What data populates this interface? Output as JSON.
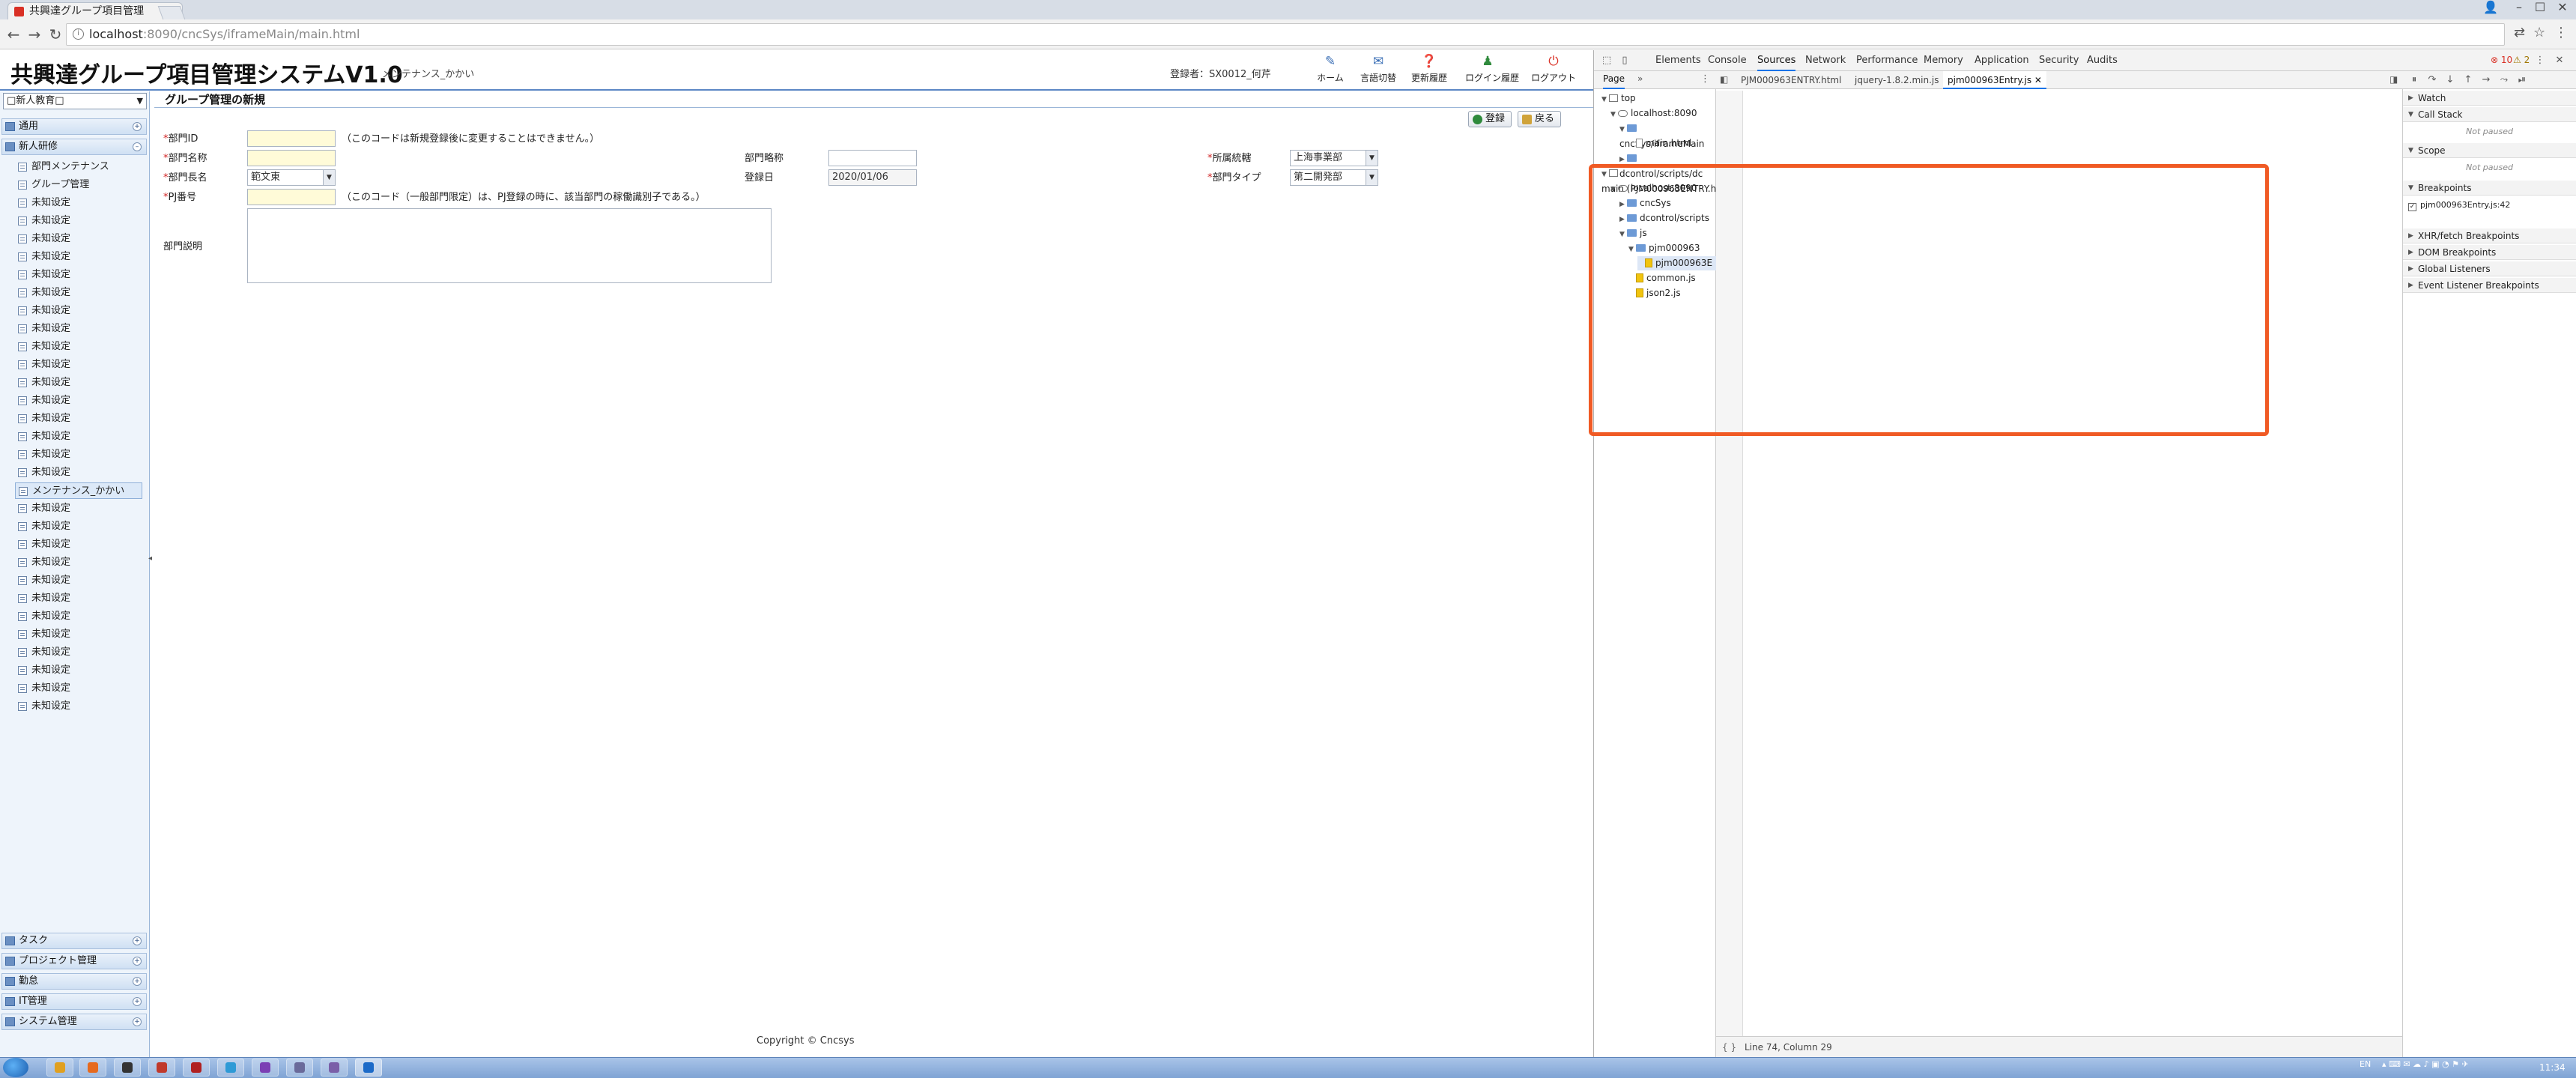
{
  "browser": {
    "tab_title": "共興達グループ項目管理",
    "url_host": "localhost",
    "url_path": ":8090/cncSys/iframeMain/main.html"
  },
  "app": {
    "title": "共興達グループ項目管理システムV1.0",
    "subtitle": "メンテナンス_かかい",
    "user_info": "登録者：SX0012_何芹",
    "header_buttons": [
      {
        "label": "ホーム",
        "icon": "home-icon"
      },
      {
        "label": "言語切替",
        "icon": "language-icon"
      },
      {
        "label": "更新履歴",
        "icon": "history-icon"
      },
      {
        "label": "ログイン履歴",
        "icon": "login-history-icon"
      },
      {
        "label": "ログアウト",
        "icon": "logout-icon"
      }
    ],
    "sidebar": {
      "dropdown_value": "□新人教育□",
      "sections_top": [
        {
          "label": "通用"
        },
        {
          "label": "新人研修"
        }
      ],
      "items": [
        "部門メンテナンス",
        "グループ管理",
        "未知设定",
        "未知设定",
        "未知设定",
        "未知设定",
        "未知设定",
        "未知设定",
        "未知设定",
        "未知设定",
        "未知设定",
        "未知设定",
        "未知设定",
        "未知设定",
        "未知设定",
        "未知设定",
        "未知设定",
        "未知设定",
        "メンテナンス_かかい",
        "未知设定",
        "未知设定",
        "未知设定",
        "未知设定",
        "未知设定",
        "未知设定",
        "未知设定",
        "未知设定",
        "未知设定",
        "未知设定",
        "未知设定",
        "未知设定"
      ],
      "selected_index": 18,
      "sections_bottom": [
        {
          "label": "タスク"
        },
        {
          "label": "プロジェクト管理"
        },
        {
          "label": "勤怠"
        },
        {
          "label": "IT管理"
        },
        {
          "label": "システム管理"
        }
      ]
    },
    "content": {
      "title": "グループ管理の新規",
      "buttons": {
        "save": "登録",
        "back": "戻る"
      },
      "fields": {
        "dept_id_label": "部門ID",
        "dept_id_value": "",
        "dept_id_note": "（このコードは新規登録後に変更することはできません。）",
        "dept_name_label": "部門名称",
        "dept_name_value": "",
        "dept_abbr_label": "部門略称",
        "dept_abbr_value": "",
        "supervisor_label": "所属統轄",
        "supervisor_value": "上海事業部",
        "manager_label": "部門長名",
        "manager_value": "範文東",
        "reg_date_label": "登録日",
        "reg_date_value": "2020/01/06",
        "dept_type_label": "部門タイプ",
        "dept_type_value": "第二開発部",
        "cost_code_label": "PJ番号",
        "cost_code_value": "",
        "cost_code_note": "（このコード（一般部門限定）は、PJ登録の時に、該当部門の稼働識別子である。）",
        "desc_label": "部門説明",
        "desc_value": ""
      },
      "copyright": "Copyright © Cncsys"
    }
  },
  "devtools": {
    "tabs": [
      "Elements",
      "Console",
      "Sources",
      "Network",
      "Performance",
      "Memory",
      "Application",
      "Security",
      "Audits"
    ],
    "active_tab": "Sources",
    "error_count": "10",
    "warning_count": "2",
    "navigator_tabs": [
      "Page",
      "»"
    ],
    "tree": [
      {
        "label": "top",
        "indent": 0,
        "type": "frame",
        "open": true
      },
      {
        "label": "localhost:8090",
        "indent": 1,
        "type": "cloud",
        "open": true
      },
      {
        "label": "cncSys/iframeMain",
        "indent": 2,
        "type": "folder",
        "open": true
      },
      {
        "label": "main.html",
        "indent": 3,
        "type": "file"
      },
      {
        "label": "dcontrol/scripts/dc",
        "indent": 2,
        "type": "folder",
        "open": false
      },
      {
        "label": "main (PJM000963ENTRY.h",
        "indent": 0,
        "type": "frame",
        "open": true
      },
      {
        "label": "localhost:8090",
        "indent": 1,
        "type": "cloud",
        "open": true
      },
      {
        "label": "cncSys",
        "indent": 2,
        "type": "folder",
        "open": false
      },
      {
        "label": "dcontrol/scripts",
        "indent": 2,
        "type": "folder",
        "open": false
      },
      {
        "label": "js",
        "indent": 2,
        "type": "folder",
        "open": true
      },
      {
        "label": "pjm000963",
        "indent": 3,
        "type": "folder",
        "open": true
      },
      {
        "label": "pjm000963E",
        "indent": 4,
        "type": "js",
        "selected": true
      },
      {
        "label": "common.js",
        "indent": 3,
        "type": "js"
      },
      {
        "label": "json2.js",
        "indent": 3,
        "type": "js"
      }
    ],
    "editor_tabs": [
      "PJM000963ENTRY.html",
      "jquery-1.8.2.min.js",
      "pjm000963Entry.js"
    ],
    "active_editor_tab": 2,
    "status": "Line 74, Column 29",
    "debug": {
      "sections": [
        "Watch",
        "Call Stack",
        "Scope",
        "Breakpoints",
        "XHR/fetch Breakpoints",
        "DOM Breakpoints",
        "Global Listeners",
        "Event Listener Breakpoints"
      ],
      "not_paused": "Not paused",
      "breakpoint_label": "pjm000963Entry.js:42"
    }
  },
  "taskbar": {
    "tray_lang": "EN",
    "clock": "11:34"
  }
}
